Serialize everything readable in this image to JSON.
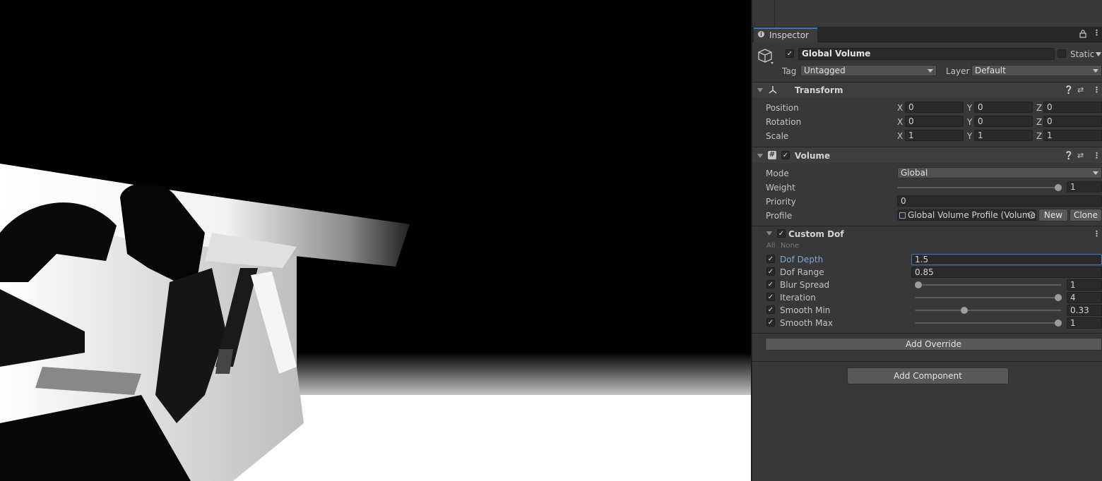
{
  "inspector": {
    "tab_label": "Inspector",
    "object": {
      "active": true,
      "name": "Global Volume",
      "static_label": "Static",
      "static_checked": false,
      "tag_label": "Tag",
      "tag_value": "Untagged",
      "layer_label": "Layer",
      "layer_value": "Default"
    },
    "transform": {
      "title": "Transform",
      "rows": [
        {
          "label": "Position",
          "x": "0",
          "y": "0",
          "z": "0"
        },
        {
          "label": "Rotation",
          "x": "0",
          "y": "0",
          "z": "0"
        },
        {
          "label": "Scale",
          "x": "1",
          "y": "1",
          "z": "1"
        }
      ],
      "axis_x": "X",
      "axis_y": "Y",
      "axis_z": "Z"
    },
    "volume": {
      "title": "Volume",
      "enabled": true,
      "mode_label": "Mode",
      "mode_value": "Global",
      "weight_label": "Weight",
      "weight_value": "1",
      "weight_fraction": 1.0,
      "priority_label": "Priority",
      "priority_value": "0",
      "profile_label": "Profile",
      "profile_value": "Global Volume Profile (Volume",
      "new_button": "New",
      "clone_button": "Clone"
    },
    "custom_dof": {
      "title": "Custom Dof",
      "enabled": true,
      "all_label": "All",
      "none_label": "None",
      "params": [
        {
          "label": "Dof Depth",
          "value": "1.5",
          "kind": "field",
          "focused": true
        },
        {
          "label": "Dof Range",
          "value": "0.85",
          "kind": "field"
        },
        {
          "label": "Blur Spread",
          "value": "1",
          "kind": "slider",
          "fraction": 0.0
        },
        {
          "label": "Iteration",
          "value": "4",
          "kind": "slider",
          "fraction": 1.0
        },
        {
          "label": "Smooth Min",
          "value": "0.33",
          "kind": "slider",
          "fraction": 0.33
        },
        {
          "label": "Smooth Max",
          "value": "1",
          "kind": "slider",
          "fraction": 1.0
        }
      ]
    },
    "add_override": "Add Override",
    "add_component": "Add Component"
  },
  "colors": {
    "panel_bg": "#383838",
    "field_bg": "#2a2a2a",
    "accent_blue": "#3a79bb",
    "scene_bg": "#000000"
  },
  "icons": [
    "info-icon",
    "lock-icon",
    "menu-icon",
    "cube-icon",
    "transform-icon",
    "help-icon",
    "preset-icon",
    "kebab-icon",
    "script-icon",
    "object-picker-icon"
  ]
}
